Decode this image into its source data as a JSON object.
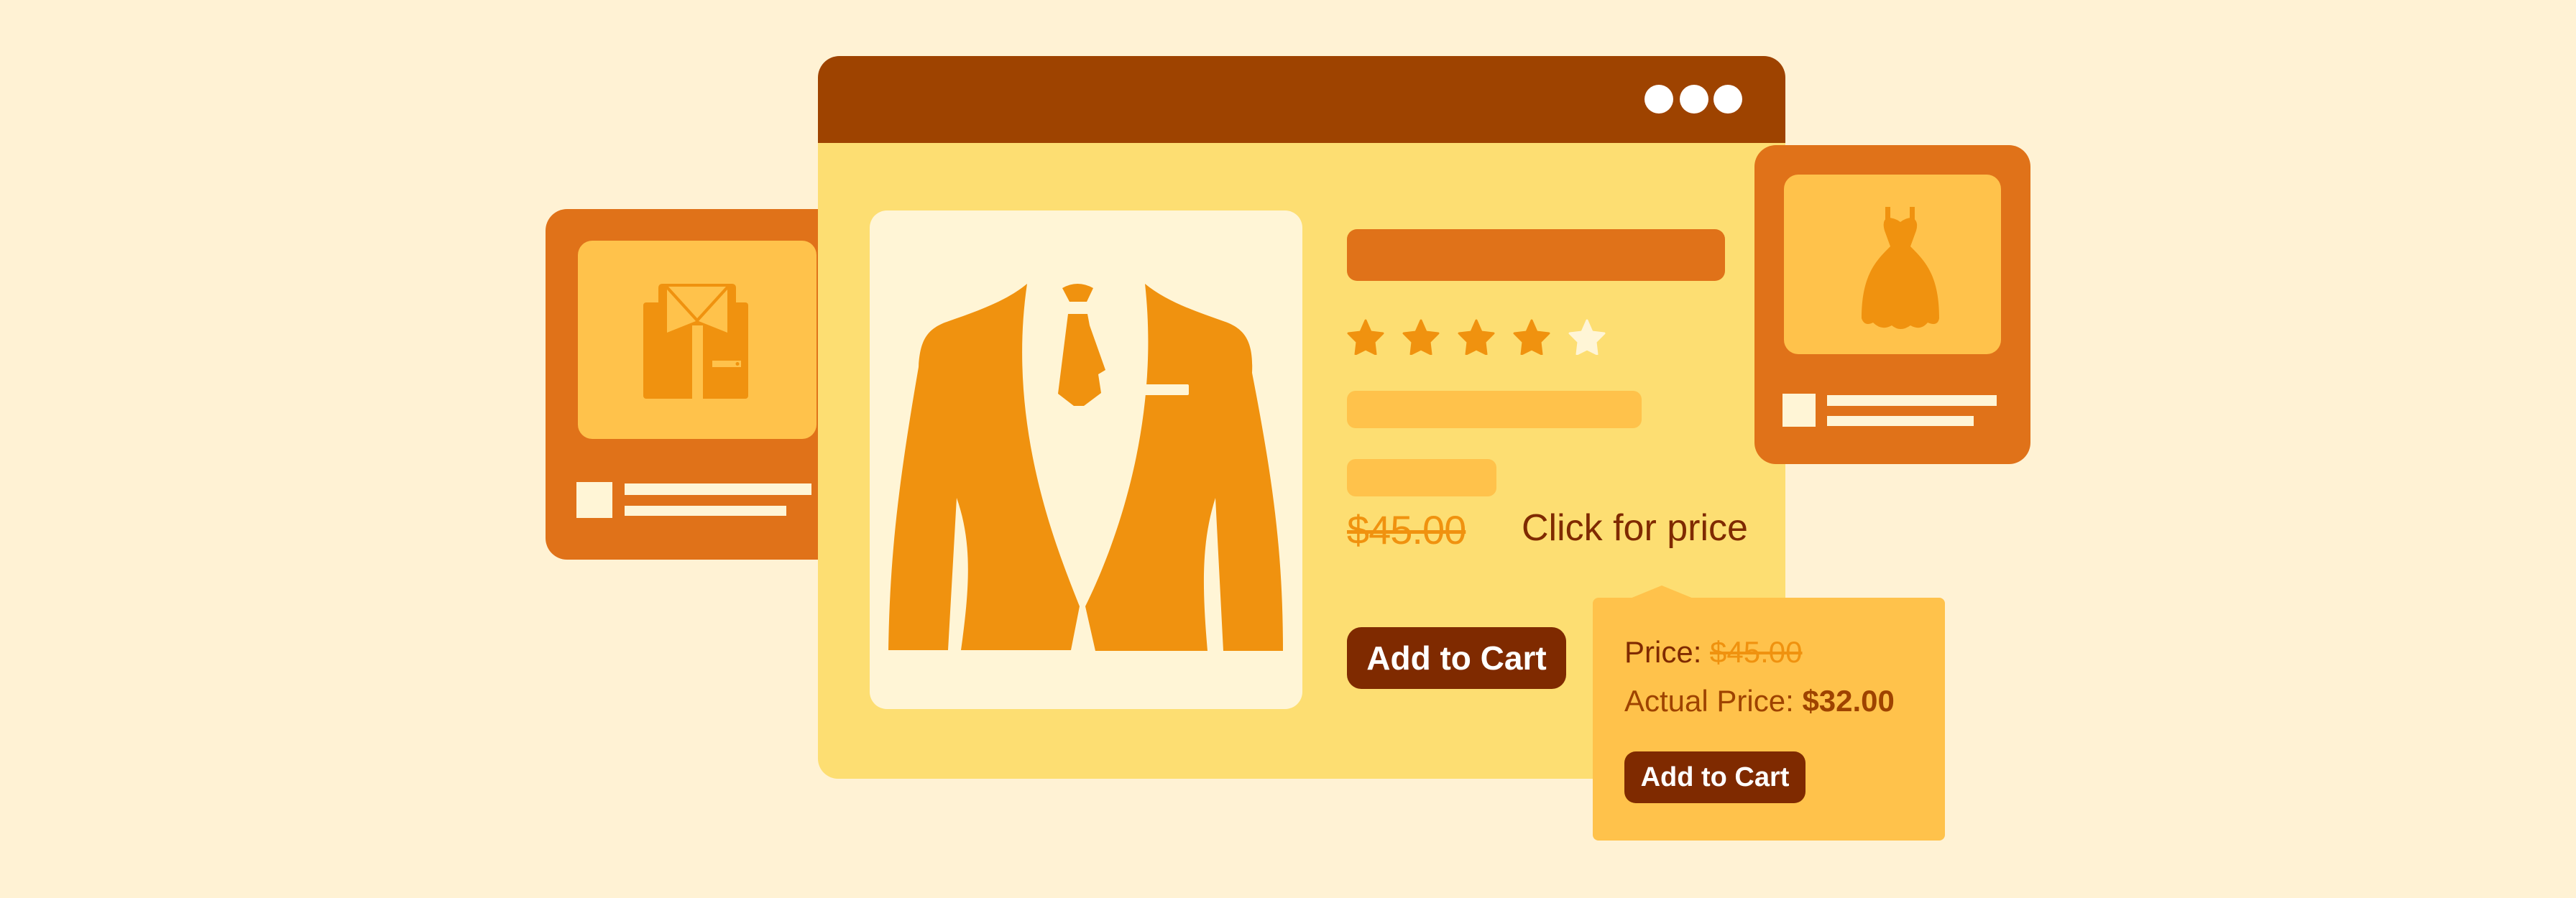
{
  "colors": {
    "background": "#FFF2D4",
    "titlebar": "#9E4300",
    "viewport": "#FDDE72",
    "accent_orange": "#E07219",
    "icon_orange": "#F0920F",
    "light_orange": "#FFC24B",
    "cream": "#FFF5D6",
    "button_dark": "#7F2A00"
  },
  "window": {
    "controls": [
      "dot",
      "dot",
      "dot"
    ]
  },
  "product": {
    "image_icon": "suit-jacket-with-tie-icon",
    "rating": {
      "value": 4,
      "max": 5
    },
    "original_price": "$45.00",
    "click_for_price_label": "Click for price",
    "add_to_cart_label": "Add to Cart"
  },
  "price_popup": {
    "price_label": "Price:",
    "price_value": "$45.00",
    "actual_price_label": "Actual Price:",
    "actual_price_value": "$32.00",
    "add_to_cart_label": "Add to Cart"
  },
  "side_cards": [
    {
      "icon": "shirt-icon"
    },
    {
      "icon": "dress-icon"
    }
  ]
}
